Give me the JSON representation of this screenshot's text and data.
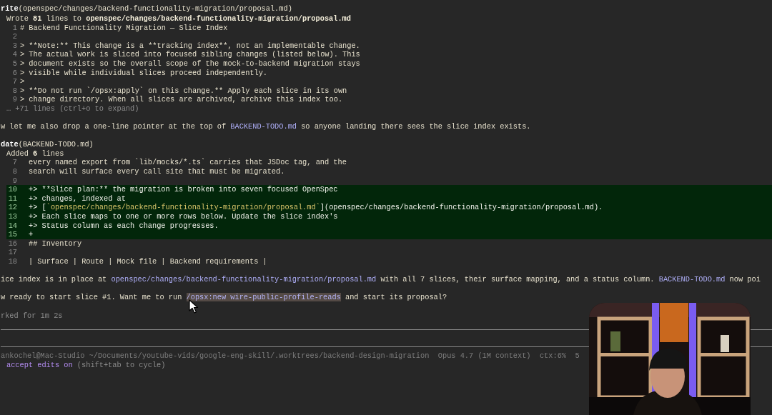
{
  "transcript": [
    {
      "kind": "tool",
      "name": "rite",
      "args": "(openspec/changes/backend-functionality-migration/proposal.md)"
    },
    {
      "kind": "result",
      "segments": [
        {
          "text": "Wrote ",
          "kind": "text"
        },
        {
          "text": "81",
          "kind": "bold"
        },
        {
          "text": " lines to ",
          "kind": "text"
        },
        {
          "text": "openspec/changes/backend-functionality-migration/proposal.md",
          "kind": "bold"
        }
      ]
    },
    {
      "kind": "code",
      "number": "1",
      "text": "# Backend Functionality Migration — Slice Index"
    },
    {
      "kind": "code",
      "number": "2"
    },
    {
      "kind": "code",
      "number": "3",
      "text": "> **Note:** This change is a **tracking index**, not an implementable change."
    },
    {
      "kind": "code",
      "number": "4",
      "text": "> The actual work is sliced into focused sibling changes (listed below). This"
    },
    {
      "kind": "code",
      "number": "5",
      "text": "> document exists so the overall scope of the mock-to-backend migration stays"
    },
    {
      "kind": "code",
      "number": "6",
      "text": "> visible while individual slices proceed independently."
    },
    {
      "kind": "code",
      "number": "7",
      "text": ">"
    },
    {
      "kind": "code",
      "number": "8",
      "text": "> **Do not run `/opsx:apply` on this change.** Apply each slice in its own"
    },
    {
      "kind": "code",
      "number": "9",
      "text": "> change directory. When all slices are archived, archive this index too."
    },
    {
      "kind": "collapsed",
      "text": "… +71 lines (ctrl+o to expand)"
    },
    {
      "kind": "blank"
    },
    {
      "kind": "message",
      "segments": [
        {
          "text": "w let me also drop a one-line pointer at the top of ",
          "kind": "text"
        },
        {
          "text": "BACKEND-TODO.md",
          "kind": "link"
        },
        {
          "text": " so anyone landing there sees the slice index exists.",
          "kind": "text"
        }
      ]
    },
    {
      "kind": "blank"
    },
    {
      "kind": "tool",
      "name": "date",
      "args": "(BACKEND-TODO.md)"
    },
    {
      "kind": "result",
      "segments": [
        {
          "text": "Added ",
          "kind": "text"
        },
        {
          "text": "6",
          "kind": "bold"
        },
        {
          "text": " lines",
          "kind": "text"
        }
      ]
    },
    {
      "kind": "diff",
      "number": "7",
      "added": false,
      "segments": [
        {
          "text": "every named export from `lib/mocks/*.ts` carries that JSDoc tag, and the",
          "kind": "text"
        }
      ]
    },
    {
      "kind": "diff",
      "number": "8",
      "added": false,
      "segments": [
        {
          "text": "search will surface every call site that must be migrated.",
          "kind": "text"
        }
      ]
    },
    {
      "kind": "diff",
      "number": "9",
      "added": false
    },
    {
      "kind": "diff",
      "number": "10",
      "added": true,
      "segments": [
        {
          "text": "+> **Slice plan:** the migration is broken into seven focused OpenSpec",
          "kind": "text"
        }
      ]
    },
    {
      "kind": "diff",
      "number": "11",
      "added": true,
      "segments": [
        {
          "text": "+> changes, indexed at",
          "kind": "text"
        }
      ]
    },
    {
      "kind": "diff",
      "number": "12",
      "added": true,
      "segments": [
        {
          "text": "+> [",
          "kind": "text"
        },
        {
          "text": "`openspec/changes/backend-functionality-migration/proposal.md`",
          "kind": "code"
        },
        {
          "text": "](openspec/changes/backend-functionality-migration/proposal.md).",
          "kind": "text"
        }
      ]
    },
    {
      "kind": "diff",
      "number": "13",
      "added": true,
      "segments": [
        {
          "text": "+> Each slice maps to one or more rows below. Update the slice index's",
          "kind": "text"
        }
      ]
    },
    {
      "kind": "diff",
      "number": "14",
      "added": true,
      "segments": [
        {
          "text": "+> Status column as each change progresses.",
          "kind": "text"
        }
      ]
    },
    {
      "kind": "diff",
      "number": "15",
      "added": true,
      "segments": [
        {
          "text": "+",
          "kind": "text"
        }
      ]
    },
    {
      "kind": "diff",
      "number": "16",
      "added": false,
      "segments": [
        {
          "text": "## Inventory",
          "kind": "text"
        }
      ]
    },
    {
      "kind": "diff",
      "number": "17",
      "added": false
    },
    {
      "kind": "diff",
      "number": "18",
      "added": false,
      "segments": [
        {
          "text": "| Surface | Route | Mock file | Backend requirements |",
          "kind": "text"
        }
      ]
    },
    {
      "kind": "blank"
    },
    {
      "kind": "message",
      "segments": [
        {
          "text": "ice index is in place at ",
          "kind": "text"
        },
        {
          "text": "openspec/changes/backend-functionality-migration/proposal.md",
          "kind": "link"
        },
        {
          "text": " with all 7 slices, their surface mapping, and a status column. ",
          "kind": "text"
        },
        {
          "text": "BACKEND-TODO.md",
          "kind": "link"
        },
        {
          "text": " now poi",
          "kind": "text"
        }
      ]
    },
    {
      "kind": "blank"
    },
    {
      "kind": "message",
      "segments": [
        {
          "text": "w ready to start slice #1. Want me to run ",
          "kind": "text"
        },
        {
          "text": "/opsx:new wire-public-profile-reads",
          "kind": "command"
        },
        {
          "text": " and start its proposal?",
          "kind": "text"
        }
      ]
    },
    {
      "kind": "blank"
    },
    {
      "kind": "timing",
      "text": "rked for 1m 2s"
    }
  ],
  "status_bar": [
    "ankochel@Mac-Studio ~/Documents/youtube-vids/google-eng-skill/.worktrees/backend-design-migration",
    "Opus 4.7 (1M context)",
    "ctx:6%",
    "5"
  ],
  "mode_line": [
    {
      "text": "accept edits on",
      "kind": "mode"
    },
    {
      "text": " (shift+tab to cycle)",
      "kind": "hint"
    }
  ],
  "webcam": {
    "kind": "picture"
  }
}
